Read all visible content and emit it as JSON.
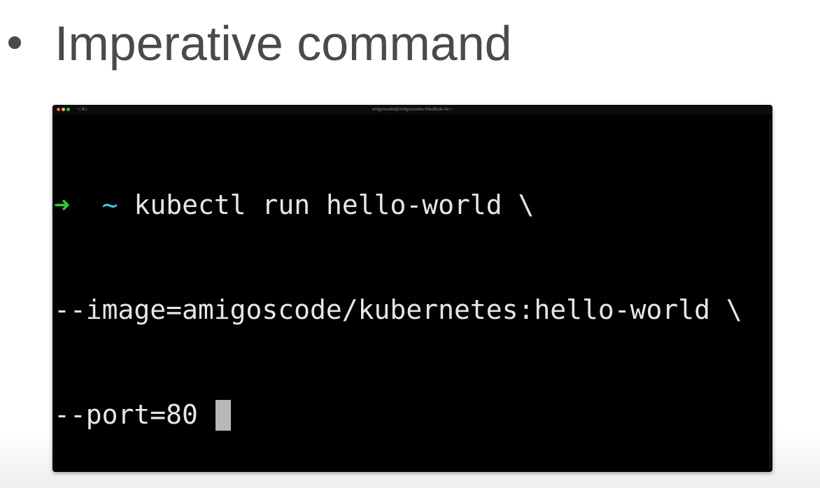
{
  "slide": {
    "title": "Imperative command"
  },
  "terminal": {
    "shortcut": "⌥⌘1",
    "window_title": "amigoscode@Amigoscodes-MacBook-Air:~",
    "prompt_arrow": "➜",
    "prompt_dir": "~",
    "lines": [
      "kubectl run hello-world \\",
      "--image=amigoscode/kubernetes:hello-world \\",
      "--port=80 "
    ],
    "colors": {
      "background": "#000000",
      "text": "#e6e6e6",
      "arrow": "#2ad12a",
      "tilde": "#3ccfe6",
      "cursor": "#b8b8b8"
    }
  }
}
